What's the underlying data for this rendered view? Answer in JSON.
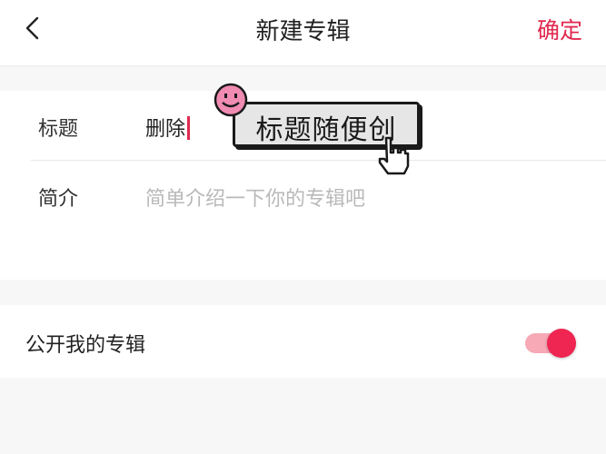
{
  "header": {
    "title": "新建专辑",
    "confirm_label": "确定"
  },
  "form": {
    "title_label": "标题",
    "title_value": "删除",
    "description_label": "简介",
    "description_placeholder": "简单介绍一下你的专辑吧"
  },
  "sticker": {
    "text": "标题随便创"
  },
  "public_album": {
    "label": "公开我的专辑",
    "enabled": true
  },
  "colors": {
    "accent": "#e0294f",
    "toggle_track": "#f7a9b6",
    "sticker_face": "#f08bb1"
  }
}
